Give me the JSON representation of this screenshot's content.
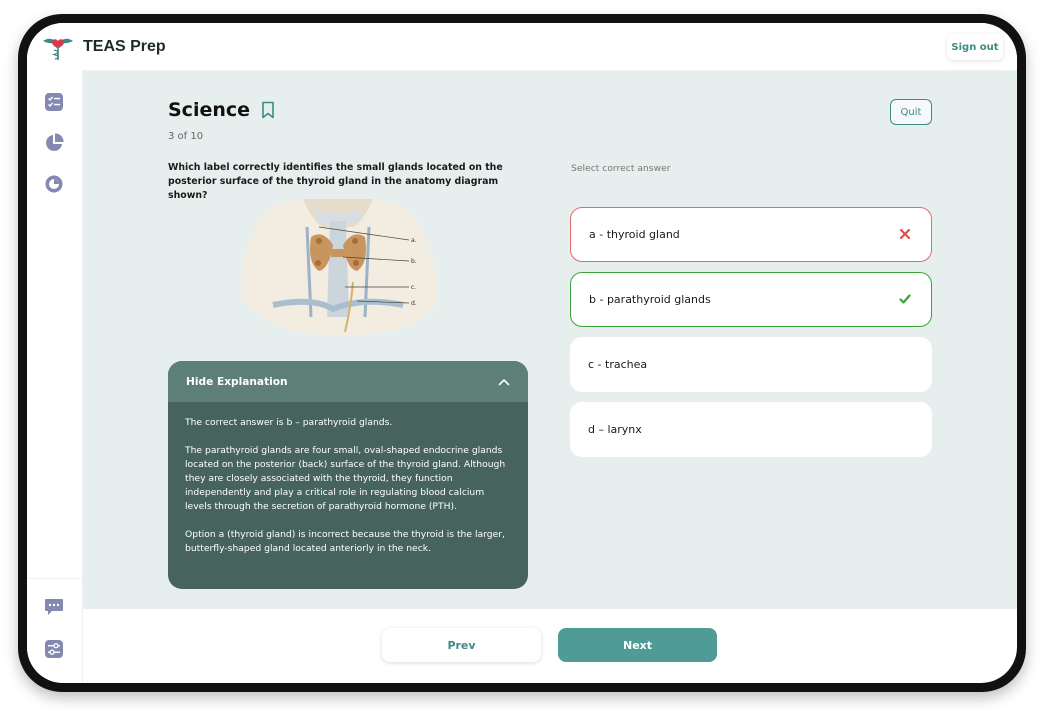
{
  "header": {
    "brand_name": "TEAS Prep",
    "sign_out_label": "Sign out",
    "logo_icon": "caduceus-heart-logo"
  },
  "sidebar": {
    "items": [
      {
        "icon": "checklist-icon"
      },
      {
        "icon": "pie-chart-icon"
      },
      {
        "icon": "progress-ring-icon"
      }
    ],
    "bottom_items": [
      {
        "icon": "chat-icon"
      },
      {
        "icon": "settings-sliders-icon"
      }
    ]
  },
  "quiz": {
    "subject": "Science",
    "progress": "3 of 10",
    "quit_label": "Quit",
    "question": "Which label correctly identifies the small glands located on the posterior surface of the thyroid gland in the anatomy diagram shown?",
    "diagram_labels": [
      "a.",
      "b.",
      "c.",
      "d."
    ],
    "select_label": "Select correct answer",
    "answers": [
      {
        "label": "a - thyroid gland",
        "state": "incorrect"
      },
      {
        "label": "b - parathyroid glands",
        "state": "correct"
      },
      {
        "label": "c - trachea",
        "state": "neutral"
      },
      {
        "label": "d – larynx",
        "state": "neutral"
      }
    ]
  },
  "explanation": {
    "toggle_label": "Hide Explanation",
    "paragraphs": [
      "The correct answer is b – parathyroid glands.",
      "The parathyroid glands are four small, oval-shaped endocrine glands located on the posterior (back) surface of the thyroid gland. Although they are closely associated with the thyroid, they function independently and play a critical role in regulating blood calcium levels through the secretion of parathyroid hormone (PTH).",
      "Option a (thyroid gland) is incorrect because the thyroid is the larger, butterfly-shaped gland located anteriorly in the neck."
    ]
  },
  "nav": {
    "prev_label": "Prev",
    "next_label": "Next"
  },
  "colors": {
    "accent": "#4f9c96",
    "correct": "#3aa33a",
    "incorrect": "#e46a6a",
    "explanation_bg": "#46645d",
    "content_bg": "#e7efee"
  }
}
